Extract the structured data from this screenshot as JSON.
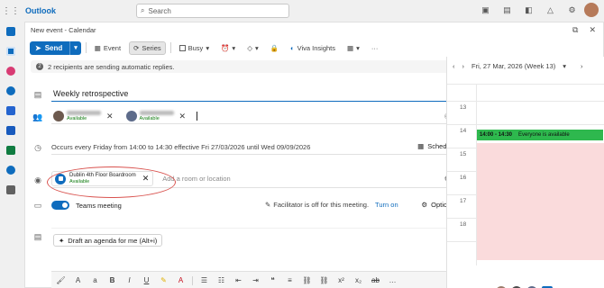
{
  "app": {
    "name": "Outlook"
  },
  "search": {
    "label": "Search"
  },
  "window": {
    "title": "New event - Calendar"
  },
  "toolbar": {
    "send": "Send",
    "event": "Event",
    "series": "Series",
    "busy": "Busy",
    "viva": "Viva Insights"
  },
  "notice": {
    "text": "2 recipients are sending automatic replies."
  },
  "form": {
    "title_value": "Weekly retrospective",
    "attendees": [
      {
        "status": "Available"
      },
      {
        "status": "Available"
      }
    ],
    "recurrence": "Occurs every Friday from 14:00 to 14:30 effective Fri 27/03/2026 until Wed 09/09/2026",
    "scheduler": "Scheduler",
    "room": {
      "name": "Dublin 4th Floor Boardroom",
      "status": "Available"
    },
    "location_placeholder": "Add a room or location",
    "teams": "Teams meeting",
    "facilitator": "Facilitator is off for this meeting.",
    "turn_on": "Turn on",
    "options": "Options",
    "draft": "Draft an agenda for me (Alt+i)"
  },
  "calendar": {
    "date": "Fri, 27 Mar, 2026 (Week 13)",
    "hours": [
      "12",
      "13",
      "14",
      "15",
      "16",
      "17",
      "18"
    ],
    "event_time": "14:00 - 14:30",
    "event_text": "Everyone is available"
  },
  "colors": {
    "accent": "#0f6cbd",
    "event": "#2eb84e",
    "busy": "#fadbdc",
    "annotation": "#d9534f"
  }
}
